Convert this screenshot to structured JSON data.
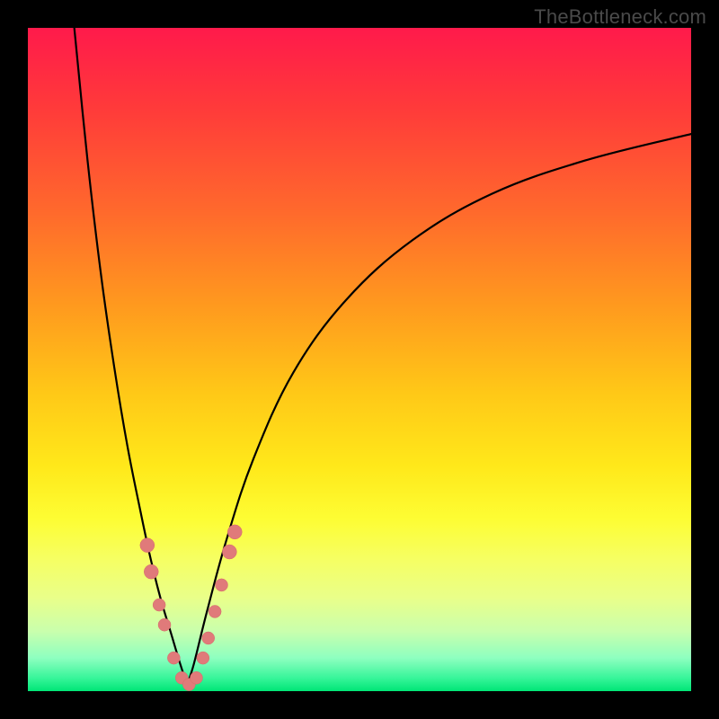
{
  "watermark": "TheBottleneck.com",
  "chart_data": {
    "type": "line",
    "title": "",
    "xlabel": "",
    "ylabel": "",
    "xlim": [
      0,
      100
    ],
    "ylim": [
      0,
      100
    ],
    "background_gradient": {
      "top": "#ff1a4b",
      "bottom": "#00e676",
      "meaning": "red=high bottleneck, green=low bottleneck"
    },
    "series": [
      {
        "name": "left-branch",
        "x": [
          7,
          9,
          11,
          13,
          15,
          17,
          18.5,
          20,
          21.5,
          23,
          24
        ],
        "y": [
          100,
          80,
          63,
          49,
          37,
          27,
          20,
          14,
          9,
          4,
          1
        ]
      },
      {
        "name": "right-branch",
        "x": [
          24,
          25,
          27,
          30,
          34,
          40,
          48,
          58,
          70,
          84,
          100
        ],
        "y": [
          1,
          4,
          12,
          23,
          35,
          48,
          59,
          68,
          75,
          80,
          84
        ]
      }
    ],
    "markers": [
      {
        "x": 18.0,
        "y": 22,
        "r": 8
      },
      {
        "x": 18.6,
        "y": 18,
        "r": 8
      },
      {
        "x": 19.8,
        "y": 13,
        "r": 7
      },
      {
        "x": 20.6,
        "y": 10,
        "r": 7
      },
      {
        "x": 22.0,
        "y": 5,
        "r": 7
      },
      {
        "x": 23.2,
        "y": 2,
        "r": 7
      },
      {
        "x": 24.3,
        "y": 1,
        "r": 7
      },
      {
        "x": 25.4,
        "y": 2,
        "r": 7
      },
      {
        "x": 26.4,
        "y": 5,
        "r": 7
      },
      {
        "x": 27.2,
        "y": 8,
        "r": 7
      },
      {
        "x": 28.2,
        "y": 12,
        "r": 7
      },
      {
        "x": 29.2,
        "y": 16,
        "r": 7
      },
      {
        "x": 30.4,
        "y": 21,
        "r": 8
      },
      {
        "x": 31.2,
        "y": 24,
        "r": 8
      }
    ]
  }
}
